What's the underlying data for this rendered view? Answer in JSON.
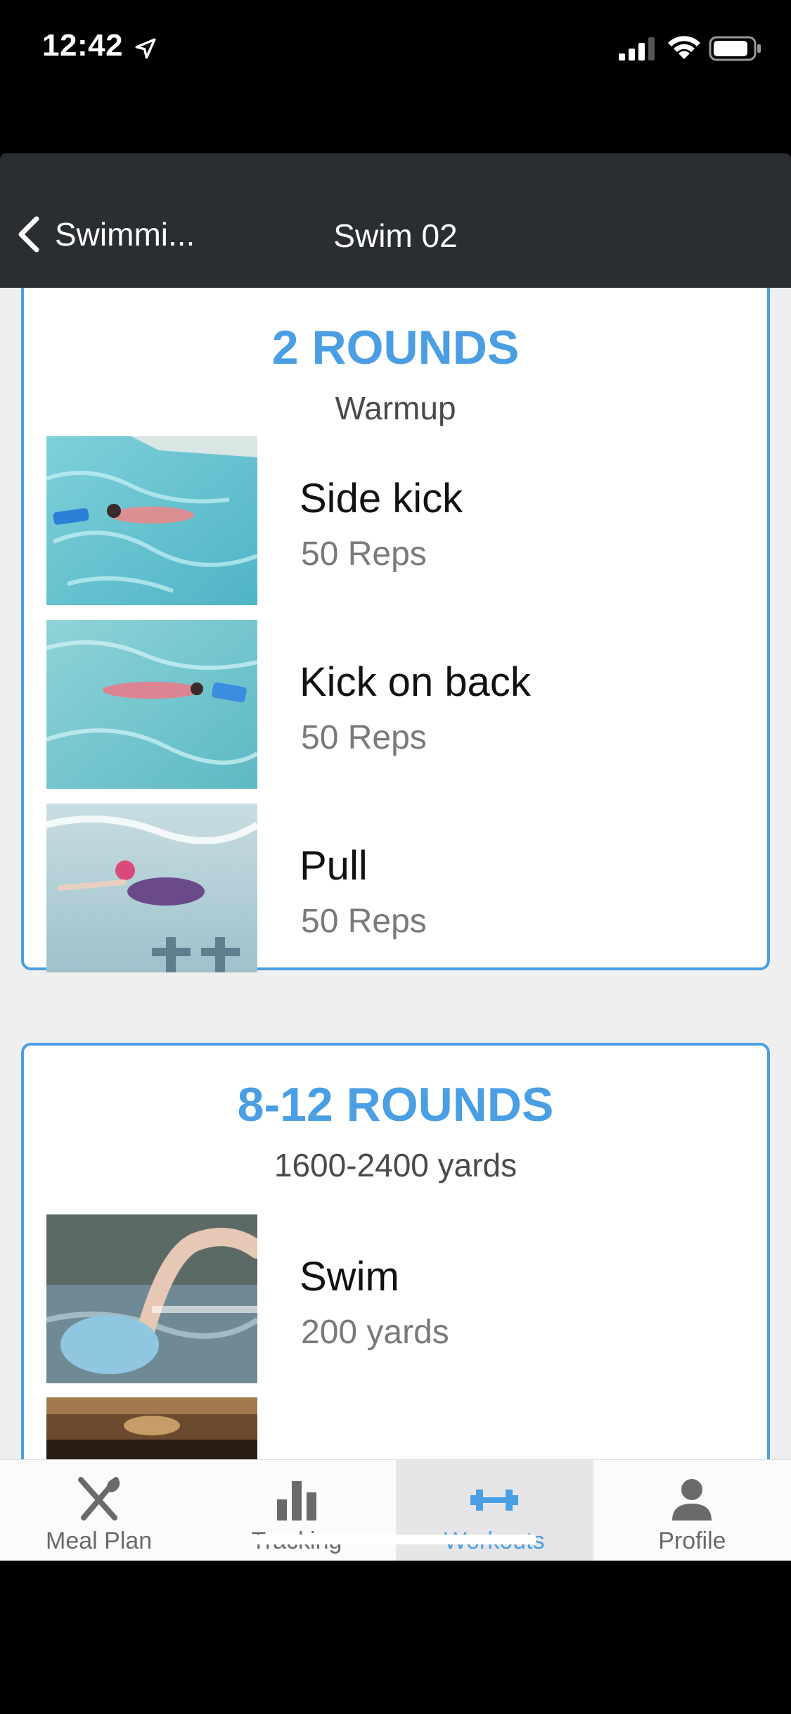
{
  "status_bar": {
    "time": "12:42",
    "icons": [
      "location-arrow-icon",
      "cellular-signal-icon",
      "wifi-icon",
      "battery-icon"
    ]
  },
  "nav": {
    "back_label": "Swimmi...",
    "title": "Swim 02"
  },
  "colors": {
    "accent": "#4a9ee3",
    "nav_bg": "#2a2d32",
    "content_bg": "#efeff0"
  },
  "rounds": [
    {
      "title": "2 ROUNDS",
      "subtitle": "Warmup",
      "exercises": [
        {
          "name": "Side kick",
          "amount": "50 Reps"
        },
        {
          "name": "Kick on back",
          "amount": "50 Reps"
        },
        {
          "name": "Pull",
          "amount": "50 Reps"
        }
      ]
    },
    {
      "title": "8-12 ROUNDS",
      "subtitle": "1600-2400 yards",
      "exercises": [
        {
          "name": "Swim",
          "amount": "200 yards"
        }
      ]
    }
  ],
  "tabs": [
    {
      "label": "Meal Plan",
      "icon": "fork-knife-icon",
      "active": false
    },
    {
      "label": "Tracking",
      "icon": "bar-chart-icon",
      "active": false
    },
    {
      "label": "Workouts",
      "icon": "dumbbell-icon",
      "active": true
    },
    {
      "label": "Profile",
      "icon": "person-icon",
      "active": false
    }
  ]
}
